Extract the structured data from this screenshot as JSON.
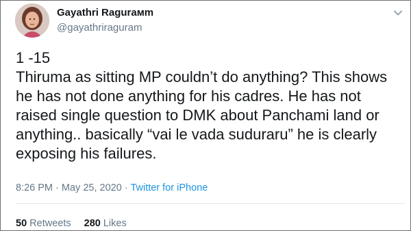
{
  "tweet": {
    "author": {
      "name": "Gayathri Ragurамm",
      "handle": "@gayathriraguram"
    },
    "text_lines": [
      "1 -15",
      "Thiruma as sitting MP couldn’t do anything? This shows",
      "he has not done anything for his cadres. He has not",
      "raised single question to DMK about Panchami land or",
      "anything.. basically “vai le vada suduraru” he is clearly",
      "exposing his failures."
    ],
    "time": "8:26 PM",
    "separator": "·",
    "date": "May 25, 2020",
    "source": "Twitter for iPhone",
    "retweets_count": "50",
    "retweets_label": "Retweets",
    "likes_count": "280",
    "likes_label": "Likes"
  },
  "icons": {
    "more": "chevron-down-icon",
    "avatar": "profile-photo"
  },
  "colors": {
    "text": "#14171a",
    "secondary": "#657786",
    "link": "#1b95e0",
    "border": "#6e6e6e"
  }
}
